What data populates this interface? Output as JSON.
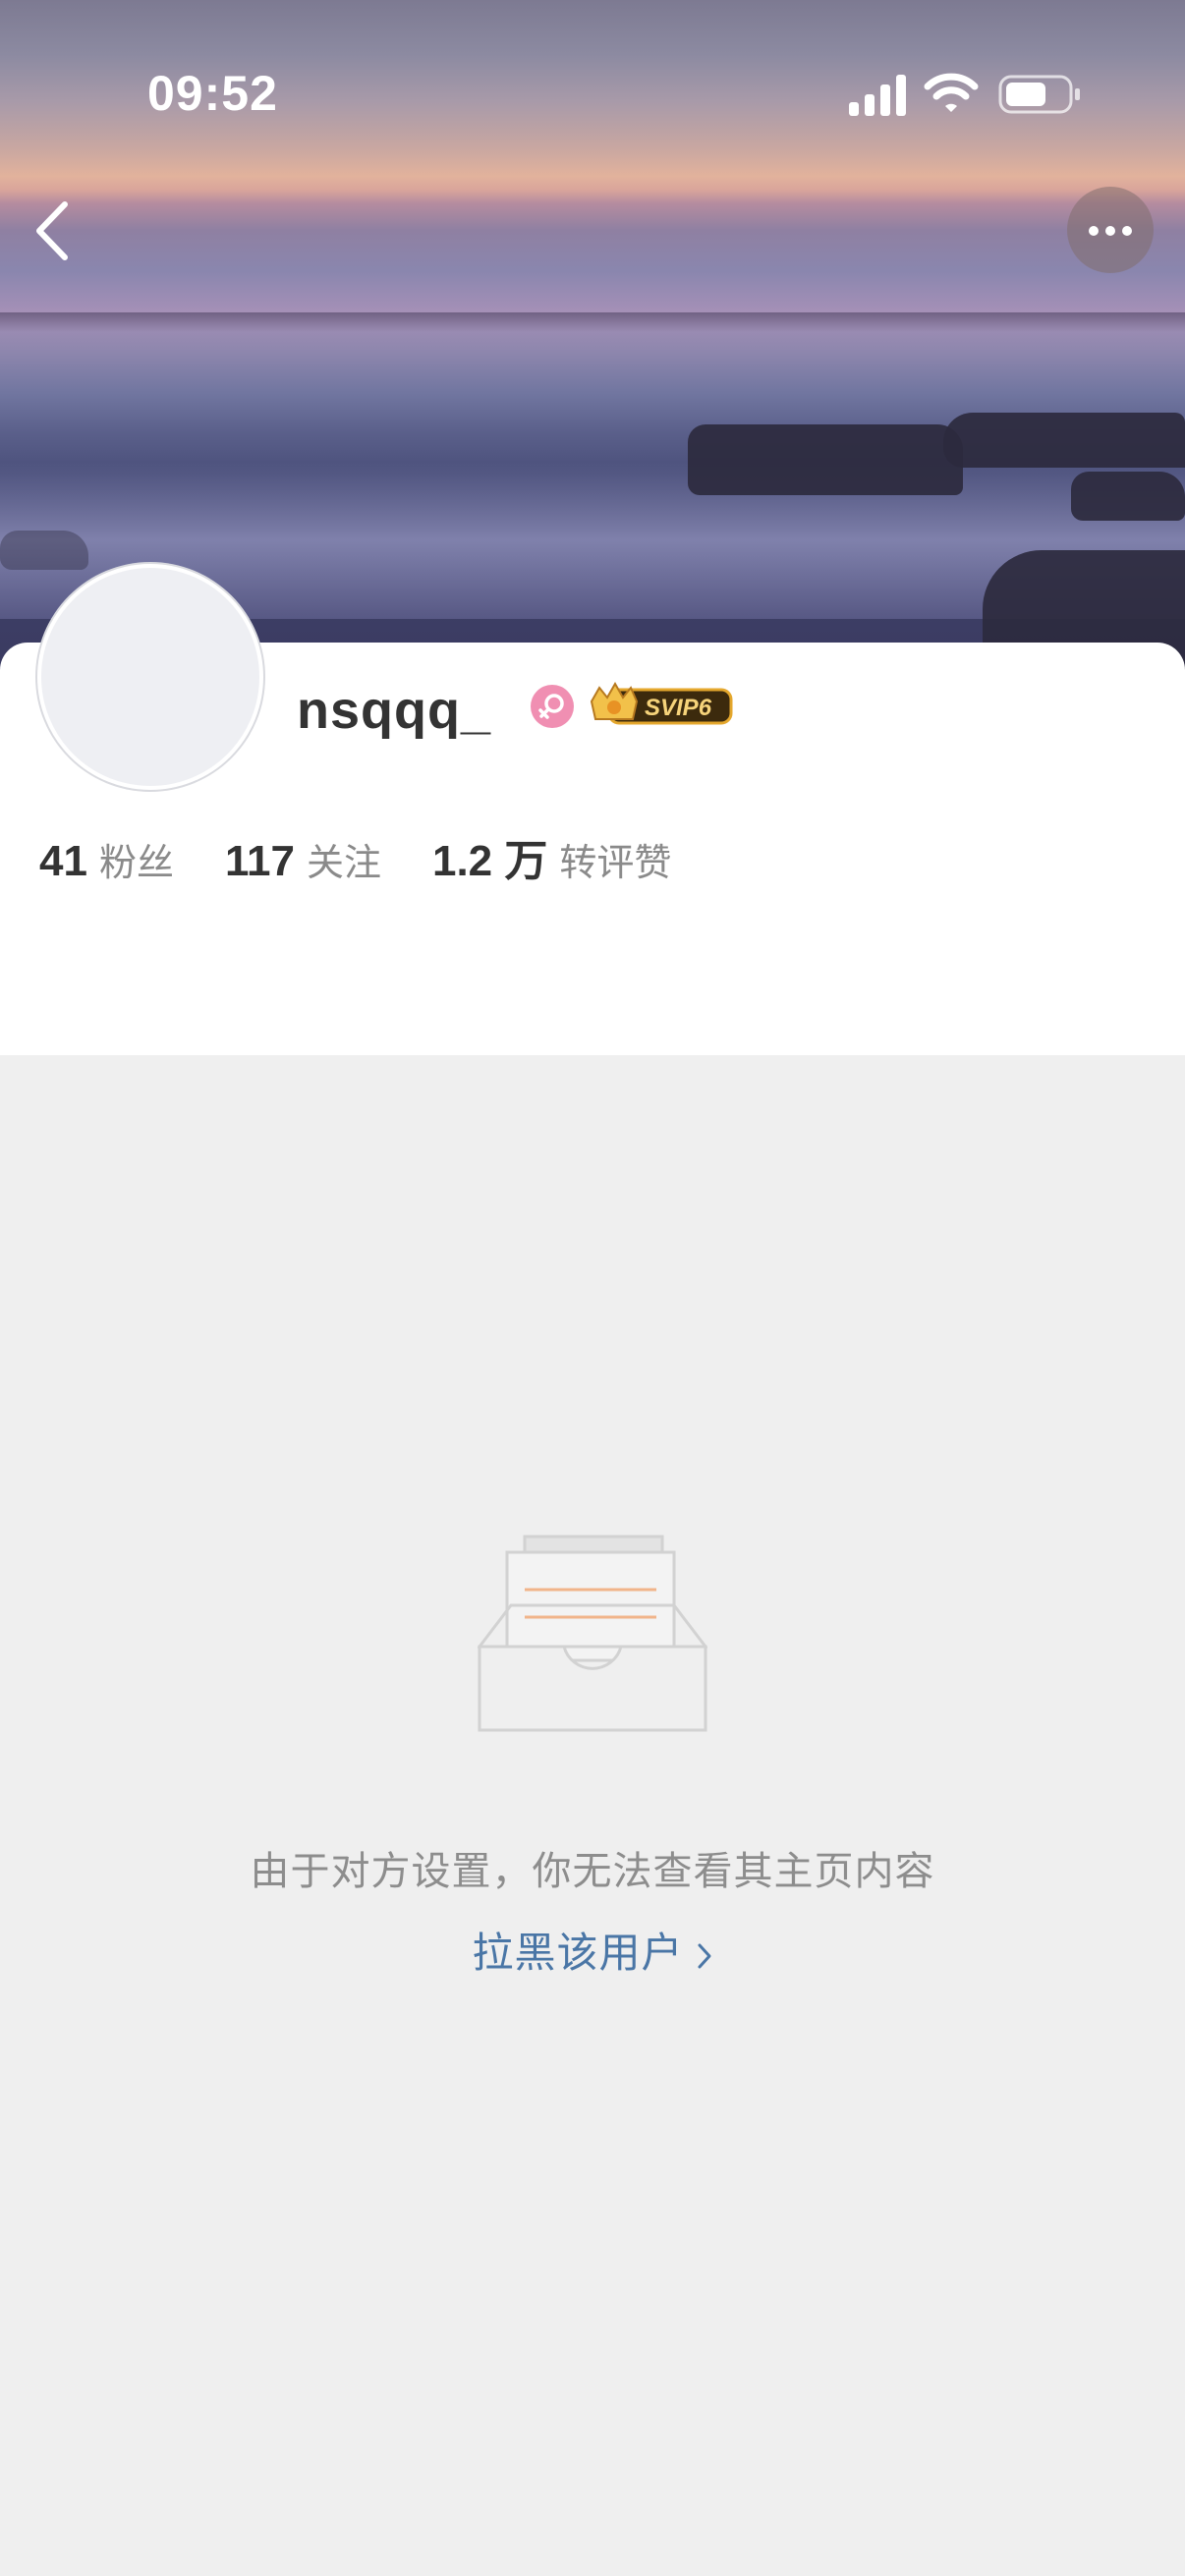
{
  "status_bar": {
    "time": "09:52"
  },
  "profile": {
    "username": "nsqqq_",
    "badge_label": "SVIP6",
    "stats": [
      {
        "value": "41",
        "label": "粉丝"
      },
      {
        "value": "117",
        "label": "关注"
      },
      {
        "value": "1.2 万",
        "label": "转评赞"
      }
    ]
  },
  "empty_state": {
    "message": "由于对方设置，你无法查看其主页内容",
    "link_label": "拉黑该用户"
  },
  "colors": {
    "link": "#4a76a6",
    "gender_female": "#f08fb2",
    "vip_gold": "#f2c14a"
  }
}
